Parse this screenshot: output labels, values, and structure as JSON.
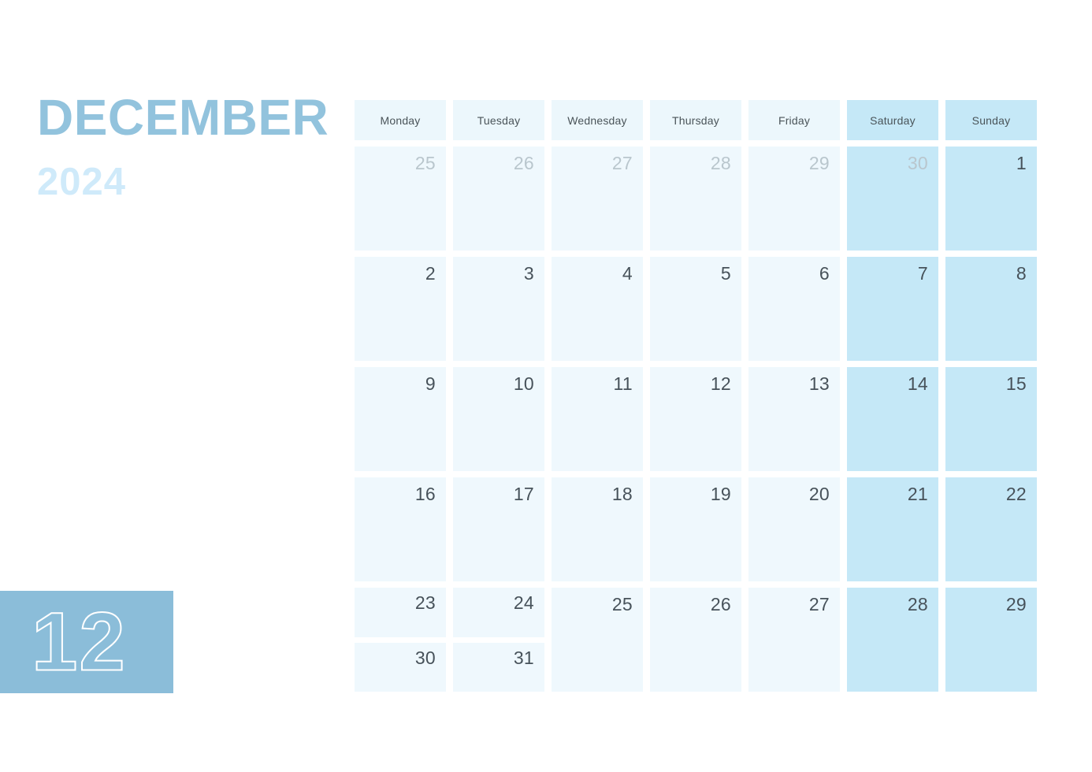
{
  "header": {
    "month": "DECEMBER",
    "year": "2024",
    "month_number": "12",
    "accent_color": "#92c3dd",
    "year_color": "#cfeafa",
    "badge_color": "#8bbdd9",
    "weekday_bg": "#ecf7fc",
    "weekend_bg": "#c5e8f7",
    "day_bg": "#eff8fd",
    "day_text_color": "#47525a",
    "other_month_text_color": "#b9c6cd"
  },
  "weekdays": [
    {
      "label": "Monday",
      "weekend": false
    },
    {
      "label": "Tuesday",
      "weekend": false
    },
    {
      "label": "Wednesday",
      "weekend": false
    },
    {
      "label": "Thursday",
      "weekend": false
    },
    {
      "label": "Friday",
      "weekend": false
    },
    {
      "label": "Saturday",
      "weekend": true
    },
    {
      "label": "Sunday",
      "weekend": true
    }
  ],
  "weeks": [
    {
      "days": [
        {
          "date": "25",
          "other_month": true,
          "weekend": false
        },
        {
          "date": "26",
          "other_month": true,
          "weekend": false
        },
        {
          "date": "27",
          "other_month": true,
          "weekend": false
        },
        {
          "date": "28",
          "other_month": true,
          "weekend": false
        },
        {
          "date": "29",
          "other_month": true,
          "weekend": false
        },
        {
          "date": "30",
          "other_month": true,
          "weekend": true
        },
        {
          "date": "1",
          "other_month": false,
          "weekend": true
        }
      ]
    },
    {
      "days": [
        {
          "date": "2",
          "other_month": false,
          "weekend": false
        },
        {
          "date": "3",
          "other_month": false,
          "weekend": false
        },
        {
          "date": "4",
          "other_month": false,
          "weekend": false
        },
        {
          "date": "5",
          "other_month": false,
          "weekend": false
        },
        {
          "date": "6",
          "other_month": false,
          "weekend": false
        },
        {
          "date": "7",
          "other_month": false,
          "weekend": true
        },
        {
          "date": "8",
          "other_month": false,
          "weekend": true
        }
      ]
    },
    {
      "days": [
        {
          "date": "9",
          "other_month": false,
          "weekend": false
        },
        {
          "date": "10",
          "other_month": false,
          "weekend": false
        },
        {
          "date": "11",
          "other_month": false,
          "weekend": false
        },
        {
          "date": "12",
          "other_month": false,
          "weekend": false
        },
        {
          "date": "13",
          "other_month": false,
          "weekend": false
        },
        {
          "date": "14",
          "other_month": false,
          "weekend": true
        },
        {
          "date": "15",
          "other_month": false,
          "weekend": true
        }
      ]
    },
    {
      "days": [
        {
          "date": "16",
          "other_month": false,
          "weekend": false
        },
        {
          "date": "17",
          "other_month": false,
          "weekend": false
        },
        {
          "date": "18",
          "other_month": false,
          "weekend": false
        },
        {
          "date": "19",
          "other_month": false,
          "weekend": false
        },
        {
          "date": "20",
          "other_month": false,
          "weekend": false
        },
        {
          "date": "21",
          "other_month": false,
          "weekend": true
        },
        {
          "date": "22",
          "other_month": false,
          "weekend": true
        }
      ]
    },
    {
      "days": [
        {
          "dates": [
            "23",
            "30"
          ],
          "other_month": false,
          "weekend": false
        },
        {
          "dates": [
            "24",
            "31"
          ],
          "other_month": false,
          "weekend": false
        },
        {
          "date": "25",
          "other_month": false,
          "weekend": false
        },
        {
          "date": "26",
          "other_month": false,
          "weekend": false
        },
        {
          "date": "27",
          "other_month": false,
          "weekend": false
        },
        {
          "date": "28",
          "other_month": false,
          "weekend": true
        },
        {
          "date": "29",
          "other_month": false,
          "weekend": true
        }
      ]
    }
  ]
}
